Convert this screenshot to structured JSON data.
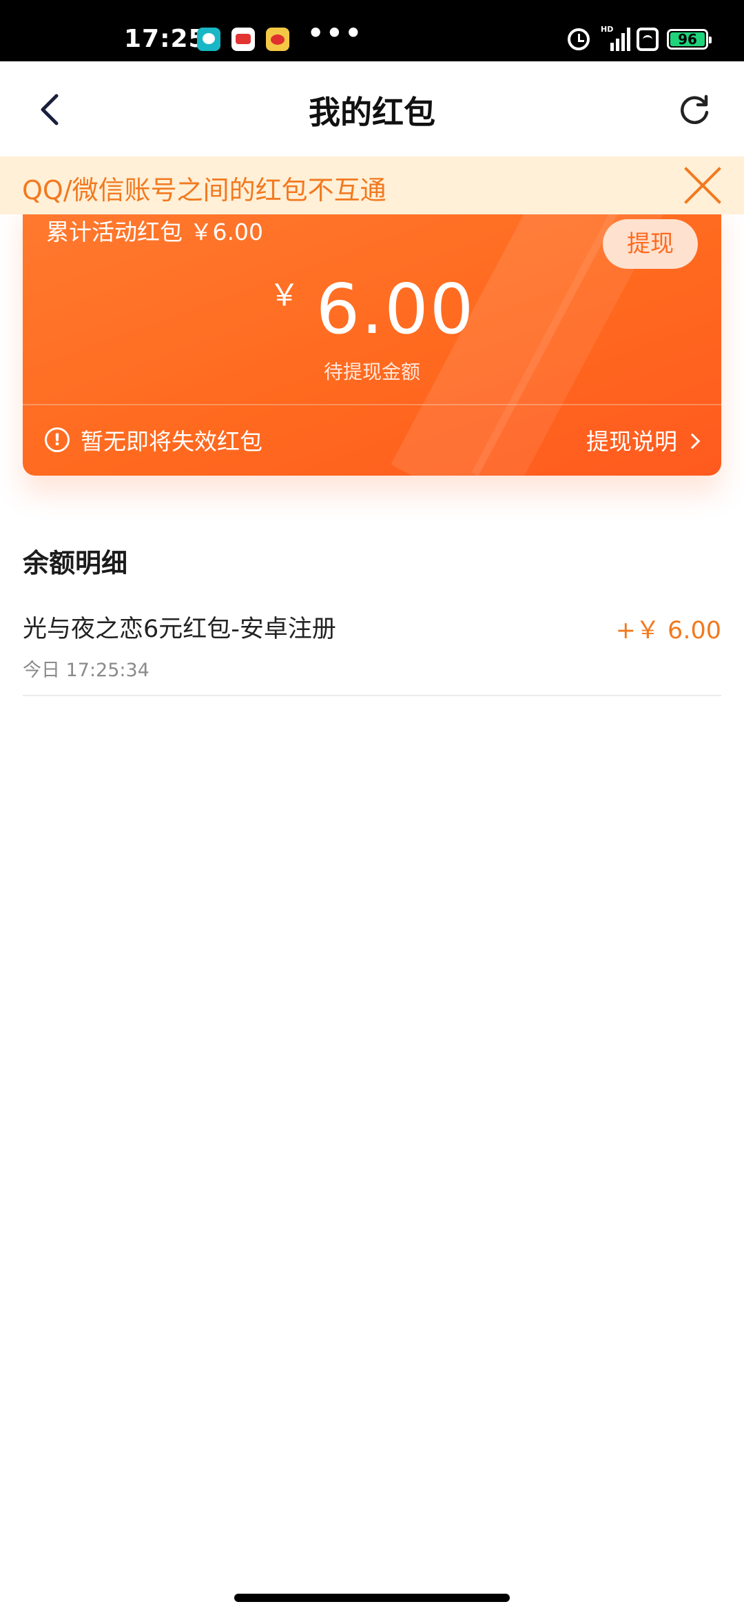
{
  "status_bar": {
    "time": "17:25",
    "more": "•••",
    "hd": "HD",
    "battery": "96",
    "battery_color": "#1fd37a"
  },
  "header": {
    "title": "我的红包",
    "back_icon": "chevron-left-icon",
    "refresh_icon": "refresh-icon"
  },
  "notice": {
    "text": "QQ/微信账号之间的红包不互通",
    "close_icon": "close-icon"
  },
  "card": {
    "total_label": "累计活动红包 ￥6.00",
    "withdraw_button": "提现",
    "currency": "￥",
    "amount": "6.00",
    "amount_label": "待提现金额",
    "warning_icon": "exclamation-circle-icon",
    "warning_text": "暂无即将失效红包",
    "explain_link": "提现说明",
    "accent_color": "#ff6a1f"
  },
  "balance": {
    "section_title": "余额明细",
    "records": [
      {
        "title": "光与夜之恋6元红包-安卓注册",
        "time": "今日 17:25:34",
        "amount": "+￥ 6.00"
      }
    ]
  }
}
